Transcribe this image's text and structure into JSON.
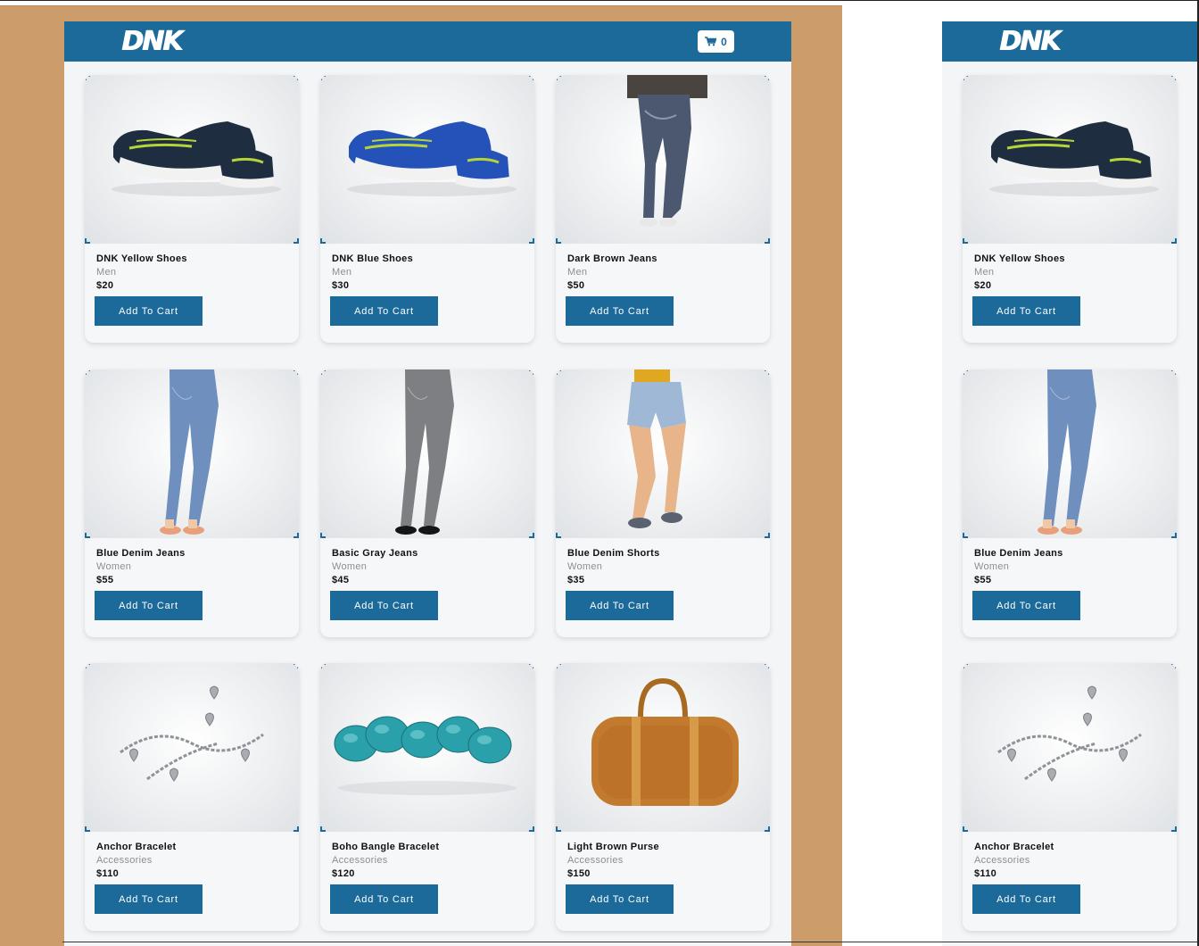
{
  "app": {
    "brand": "DNK",
    "cart_count": "0",
    "accent_color": "#1b6a9a",
    "backdrop_color": "#cc9d6b"
  },
  "products": [
    {
      "name": "DNK Yellow Shoes",
      "category": "Men",
      "price": "$20",
      "button": "Add To Cart",
      "icon": "sneaker-yellow"
    },
    {
      "name": "DNK Blue Shoes",
      "category": "Men",
      "price": "$30",
      "button": "Add To Cart",
      "icon": "sneaker-blue"
    },
    {
      "name": "Dark Brown Jeans",
      "category": "Men",
      "price": "$50",
      "button": "Add To Cart",
      "icon": "mens-jeans"
    },
    {
      "name": "Blue Denim Jeans",
      "category": "Women",
      "price": "$55",
      "button": "Add To Cart",
      "icon": "womens-blue-jeans"
    },
    {
      "name": "Basic Gray Jeans",
      "category": "Women",
      "price": "$45",
      "button": "Add To Cart",
      "icon": "womens-gray-jeans"
    },
    {
      "name": "Blue Denim Shorts",
      "category": "Women",
      "price": "$35",
      "button": "Add To Cart",
      "icon": "denim-shorts"
    },
    {
      "name": "Anchor Bracelet",
      "category": "Accessories",
      "price": "$110",
      "button": "Add To Cart",
      "icon": "charm-bracelet"
    },
    {
      "name": "Boho Bangle Bracelet",
      "category": "Accessories",
      "price": "$120",
      "button": "Add To Cart",
      "icon": "turquoise-bangle"
    },
    {
      "name": "Light Brown Purse",
      "category": "Accessories",
      "price": "$150",
      "button": "Add To Cart",
      "icon": "leather-purse"
    }
  ],
  "mobile_products": [
    {
      "name": "DNK Yellow Shoes",
      "category": "Men",
      "price": "$20",
      "button": "Add To Cart",
      "icon": "sneaker-yellow"
    },
    {
      "name": "Blue Denim Jeans",
      "category": "Women",
      "price": "$55",
      "button": "Add To Cart",
      "icon": "womens-blue-jeans"
    },
    {
      "name": "Anchor Bracelet",
      "category": "Accessories",
      "price": "$110",
      "button": "Add To Cart",
      "icon": "charm-bracelet"
    }
  ]
}
